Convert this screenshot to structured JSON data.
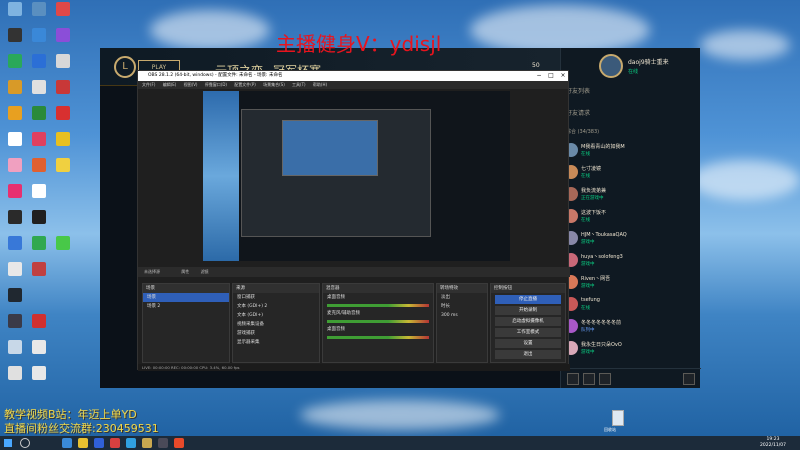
{
  "overlay": {
    "top_text": "主播健身V：ydisjl",
    "bottom_line1": "教学视频B站：年迈上单YD",
    "bottom_line2": "直播间粉丝交流群:230459531"
  },
  "league": {
    "logo": "L",
    "play_label": "PLAY",
    "nav": [
      "云顶之弈",
      "冠军杯赛"
    ],
    "currency": "50",
    "friends_panel": {
      "username": "daoj9骑士重来",
      "status": "在线",
      "list_title": "好友列表",
      "requests_label": "好友请求",
      "group_label": "综合 (34/383)",
      "friends": [
        {
          "name": "M我看青山的如我M",
          "status": "在线",
          "color": "#0acf83"
        },
        {
          "name": "七寸凌镜",
          "status": "在线",
          "color": "#0acf83"
        },
        {
          "name": "我负流弟兼",
          "status": "正在游戏中",
          "color": "#0acf83"
        },
        {
          "name": "这波下饭不",
          "status": "在线",
          "color": "#0acf83"
        },
        {
          "name": "HJM丶ToukasaQAQ",
          "status": "游戏中",
          "color": "#0acf83"
        },
        {
          "name": "huya丶solofeng3",
          "status": "游戏中",
          "color": "#0acf83"
        },
        {
          "name": "Riven丶网吾",
          "status": "游戏中",
          "color": "#0acf83"
        },
        {
          "name": "tsefung",
          "status": "在线",
          "color": "#0acf83"
        },
        {
          "name": "冬冬冬冬冬冬冬前",
          "status": "队列中",
          "color": "#6aa1ff"
        },
        {
          "name": "我永生日只朵OvO",
          "status": "游戏中",
          "color": "#0acf83"
        }
      ]
    }
  },
  "obs": {
    "title": "OBS 28.1.2 (64-bit, windows) - 配置文件: 未命名 - 场景: 未命名",
    "menu": [
      "文件(F)",
      "编辑(E)",
      "视图(V)",
      "停靠窗口(D)",
      "配置文件(P)",
      "场景集合(S)",
      "工具(T)",
      "帮助(H)"
    ],
    "source_bar": "未选择源",
    "bar_buttons": [
      "属性",
      "滤镜"
    ],
    "docks": {
      "scenes": {
        "title": "场景",
        "items": [
          "场景",
          "场景 2"
        ]
      },
      "sources": {
        "title": "来源",
        "items": [
          "窗口捕获",
          "文本 (GDI+) 2",
          "文本 (GDI+)",
          "视频采集设备",
          "游戏捕获",
          "显示器采集"
        ]
      },
      "mixer": {
        "title": "混音器",
        "items": [
          "桌面音频",
          "麦克风/辅助音频",
          "桌面音频"
        ]
      },
      "transitions": {
        "title": "转场特效",
        "type": "淡出",
        "duration_label": "时长",
        "duration": "300 ms"
      },
      "controls": {
        "title": "控制按钮",
        "buttons": [
          "停止直播",
          "开始录制",
          "启动虚拟摄像机",
          "工作室模式",
          "设置",
          "退出"
        ]
      }
    },
    "status": "LIVE: 00:00:00  REC: 00:00:00  CPU: 3.4%, 60.00 fps"
  },
  "taskbar": {
    "time": "19:23",
    "date": "2022/11/07"
  },
  "desktop": {
    "recycle_label": "回收站"
  }
}
